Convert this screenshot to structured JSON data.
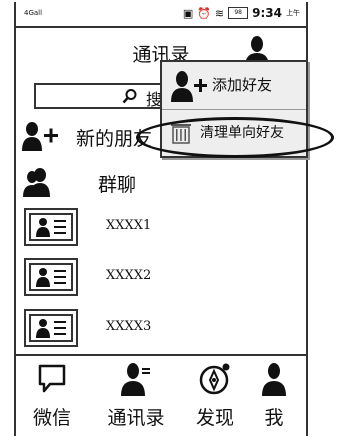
{
  "status": {
    "signal": "4Gall",
    "time": "9:34",
    "ampm": "上午",
    "battery": "98"
  },
  "header": {
    "title": "通讯录"
  },
  "search": {
    "placeholder": "搜"
  },
  "contacts": {
    "new_friends": "新的朋友",
    "group_chat": "群聊",
    "items": [
      "XXXX1",
      "XXXX2",
      "XXXX3"
    ]
  },
  "popup": {
    "add_friend": "添加好友",
    "clean_one_way": "清理单向好友"
  },
  "tabbar": {
    "tabs": [
      "微信",
      "通讯录",
      "发现",
      "我"
    ]
  }
}
